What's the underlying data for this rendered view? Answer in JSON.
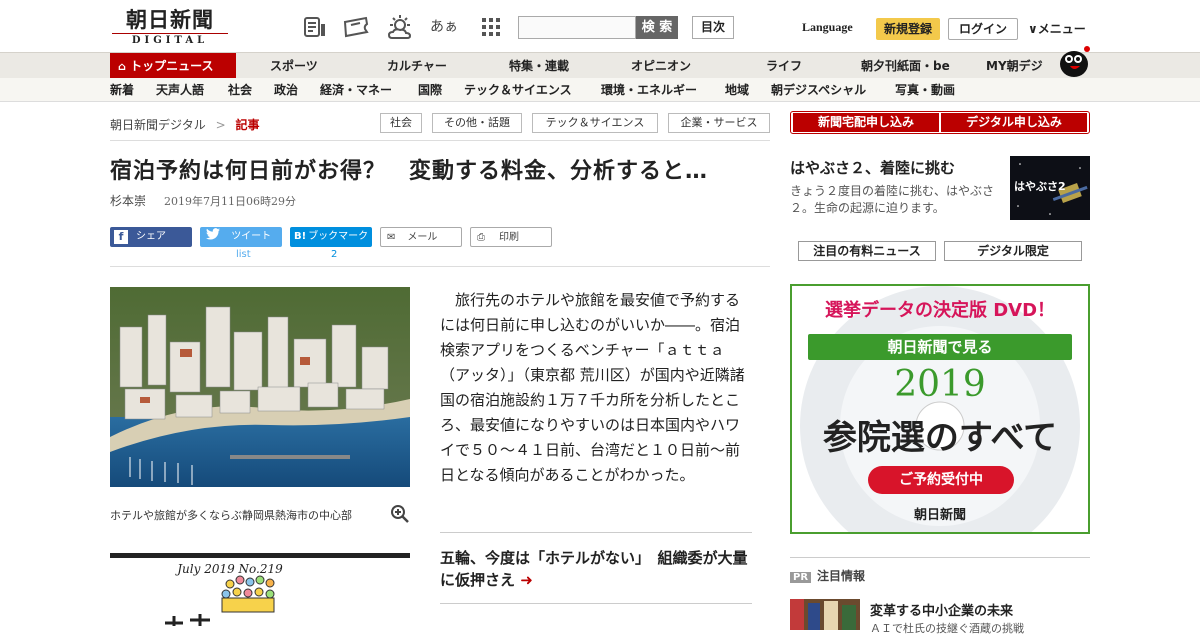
{
  "logo": {
    "jp": "朝日新聞",
    "en": "DIGITAL"
  },
  "toolbar": {
    "ah_label": "あぁ",
    "search_button": "検 索",
    "toc_button": "目次",
    "language": "Language",
    "register": "新規登録",
    "login": "ログイン",
    "menu": "∨メニュー"
  },
  "nav_main": [
    "トップニュース",
    "スポーツ",
    "カルチャー",
    "特集・連載",
    "オピニオン",
    "ライフ",
    "朝夕刊紙面・be",
    "MY朝デジ"
  ],
  "nav_sub": [
    "新着",
    "天声人語",
    "社会",
    "政治",
    "経済・マネー",
    "国際",
    "テック＆サイエンス",
    "環境・エネルギー",
    "地域",
    "朝デジスペシャル",
    "写真・動画"
  ],
  "breadcrumb": {
    "home": "朝日新聞デジタル",
    "sep": ">",
    "current": "記事"
  },
  "tags": [
    "社会",
    "その他・話題",
    "テック＆サイエンス",
    "企業・サービス"
  ],
  "article": {
    "title": "宿泊予約は何日前がお得？　変動する料金、分析すると…",
    "author": "杉本崇",
    "date": "2019年7月11日06時29分",
    "body": "旅行先のホテルや旅館を最安値で予約するには何日前に申し込むのがいいか――。宿泊検索アプリをつくるベンチャー「ａｔｔａ（アッタ）」（東京都 荒川区）が国内や近隣諸国の宿泊施設約１万７千カ所を分析したところ、最安値になりやすいのは日本国内やハワイで５０～４１日前、台湾だと１０日前～前日となる傾向があることがわかった。",
    "caption": "ホテルや旅館が多くならぶ静岡県熱海市の中心部",
    "related": "五輪、今度は「ホテルがない」　組織委が大量に仮押さえ"
  },
  "share": {
    "facebook": "シェア",
    "twitter": "ツイート",
    "twitter_sub": "list",
    "hatena": "ブックマーク",
    "hatena_sub": "2",
    "mail": "メール",
    "print": "印刷"
  },
  "magazine": {
    "issue": "July 2019 No.219"
  },
  "sidebar": {
    "subscribe_paper": "新聞宅配申し込み",
    "subscribe_digital": "デジタル申し込み",
    "feature_title": "はやぶさ２、着陸に挑む",
    "feature_desc": "きょう２度目の着陸に挑む、はやぶさ２。生命の起源に迫ります。",
    "feature_img_text": "はやぶさ2",
    "tab_paid": "注目の有料ニュース",
    "tab_digital": "デジタル限定",
    "ad": {
      "headline": "選挙データの決定版 DVD！",
      "band": "朝日新聞で見る",
      "year": "2019",
      "title": "参院選のすべて",
      "cta": "ご予約受付中",
      "brand": "朝日新聞"
    },
    "pr_badge": "PR",
    "pr_heading": "注目情報",
    "pr_title": "変革する中小企業の未来",
    "pr_desc": "ＡＩで杜氏の技継ぐ酒蔵の挑戦"
  },
  "colors": {
    "brand_red": "#b00000",
    "accent_yellow": "#f3c94b",
    "ad_green": "#4a9e2f"
  }
}
